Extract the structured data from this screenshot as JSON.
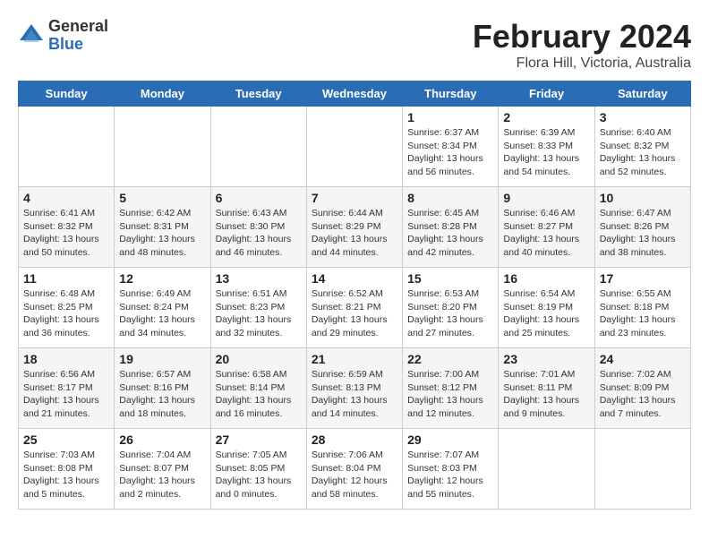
{
  "header": {
    "logo": {
      "general": "General",
      "blue": "Blue"
    },
    "title": "February 2024",
    "location": "Flora Hill, Victoria, Australia"
  },
  "days_of_week": [
    "Sunday",
    "Monday",
    "Tuesday",
    "Wednesday",
    "Thursday",
    "Friday",
    "Saturday"
  ],
  "weeks": [
    [
      {
        "day": "",
        "info": ""
      },
      {
        "day": "",
        "info": ""
      },
      {
        "day": "",
        "info": ""
      },
      {
        "day": "",
        "info": ""
      },
      {
        "day": "1",
        "info": "Sunrise: 6:37 AM\nSunset: 8:34 PM\nDaylight: 13 hours\nand 56 minutes."
      },
      {
        "day": "2",
        "info": "Sunrise: 6:39 AM\nSunset: 8:33 PM\nDaylight: 13 hours\nand 54 minutes."
      },
      {
        "day": "3",
        "info": "Sunrise: 6:40 AM\nSunset: 8:32 PM\nDaylight: 13 hours\nand 52 minutes."
      }
    ],
    [
      {
        "day": "4",
        "info": "Sunrise: 6:41 AM\nSunset: 8:32 PM\nDaylight: 13 hours\nand 50 minutes."
      },
      {
        "day": "5",
        "info": "Sunrise: 6:42 AM\nSunset: 8:31 PM\nDaylight: 13 hours\nand 48 minutes."
      },
      {
        "day": "6",
        "info": "Sunrise: 6:43 AM\nSunset: 8:30 PM\nDaylight: 13 hours\nand 46 minutes."
      },
      {
        "day": "7",
        "info": "Sunrise: 6:44 AM\nSunset: 8:29 PM\nDaylight: 13 hours\nand 44 minutes."
      },
      {
        "day": "8",
        "info": "Sunrise: 6:45 AM\nSunset: 8:28 PM\nDaylight: 13 hours\nand 42 minutes."
      },
      {
        "day": "9",
        "info": "Sunrise: 6:46 AM\nSunset: 8:27 PM\nDaylight: 13 hours\nand 40 minutes."
      },
      {
        "day": "10",
        "info": "Sunrise: 6:47 AM\nSunset: 8:26 PM\nDaylight: 13 hours\nand 38 minutes."
      }
    ],
    [
      {
        "day": "11",
        "info": "Sunrise: 6:48 AM\nSunset: 8:25 PM\nDaylight: 13 hours\nand 36 minutes."
      },
      {
        "day": "12",
        "info": "Sunrise: 6:49 AM\nSunset: 8:24 PM\nDaylight: 13 hours\nand 34 minutes."
      },
      {
        "day": "13",
        "info": "Sunrise: 6:51 AM\nSunset: 8:23 PM\nDaylight: 13 hours\nand 32 minutes."
      },
      {
        "day": "14",
        "info": "Sunrise: 6:52 AM\nSunset: 8:21 PM\nDaylight: 13 hours\nand 29 minutes."
      },
      {
        "day": "15",
        "info": "Sunrise: 6:53 AM\nSunset: 8:20 PM\nDaylight: 13 hours\nand 27 minutes."
      },
      {
        "day": "16",
        "info": "Sunrise: 6:54 AM\nSunset: 8:19 PM\nDaylight: 13 hours\nand 25 minutes."
      },
      {
        "day": "17",
        "info": "Sunrise: 6:55 AM\nSunset: 8:18 PM\nDaylight: 13 hours\nand 23 minutes."
      }
    ],
    [
      {
        "day": "18",
        "info": "Sunrise: 6:56 AM\nSunset: 8:17 PM\nDaylight: 13 hours\nand 21 minutes."
      },
      {
        "day": "19",
        "info": "Sunrise: 6:57 AM\nSunset: 8:16 PM\nDaylight: 13 hours\nand 18 minutes."
      },
      {
        "day": "20",
        "info": "Sunrise: 6:58 AM\nSunset: 8:14 PM\nDaylight: 13 hours\nand 16 minutes."
      },
      {
        "day": "21",
        "info": "Sunrise: 6:59 AM\nSunset: 8:13 PM\nDaylight: 13 hours\nand 14 minutes."
      },
      {
        "day": "22",
        "info": "Sunrise: 7:00 AM\nSunset: 8:12 PM\nDaylight: 13 hours\nand 12 minutes."
      },
      {
        "day": "23",
        "info": "Sunrise: 7:01 AM\nSunset: 8:11 PM\nDaylight: 13 hours\nand 9 minutes."
      },
      {
        "day": "24",
        "info": "Sunrise: 7:02 AM\nSunset: 8:09 PM\nDaylight: 13 hours\nand 7 minutes."
      }
    ],
    [
      {
        "day": "25",
        "info": "Sunrise: 7:03 AM\nSunset: 8:08 PM\nDaylight: 13 hours\nand 5 minutes."
      },
      {
        "day": "26",
        "info": "Sunrise: 7:04 AM\nSunset: 8:07 PM\nDaylight: 13 hours\nand 2 minutes."
      },
      {
        "day": "27",
        "info": "Sunrise: 7:05 AM\nSunset: 8:05 PM\nDaylight: 13 hours\nand 0 minutes."
      },
      {
        "day": "28",
        "info": "Sunrise: 7:06 AM\nSunset: 8:04 PM\nDaylight: 12 hours\nand 58 minutes."
      },
      {
        "day": "29",
        "info": "Sunrise: 7:07 AM\nSunset: 8:03 PM\nDaylight: 12 hours\nand 55 minutes."
      },
      {
        "day": "",
        "info": ""
      },
      {
        "day": "",
        "info": ""
      }
    ]
  ]
}
